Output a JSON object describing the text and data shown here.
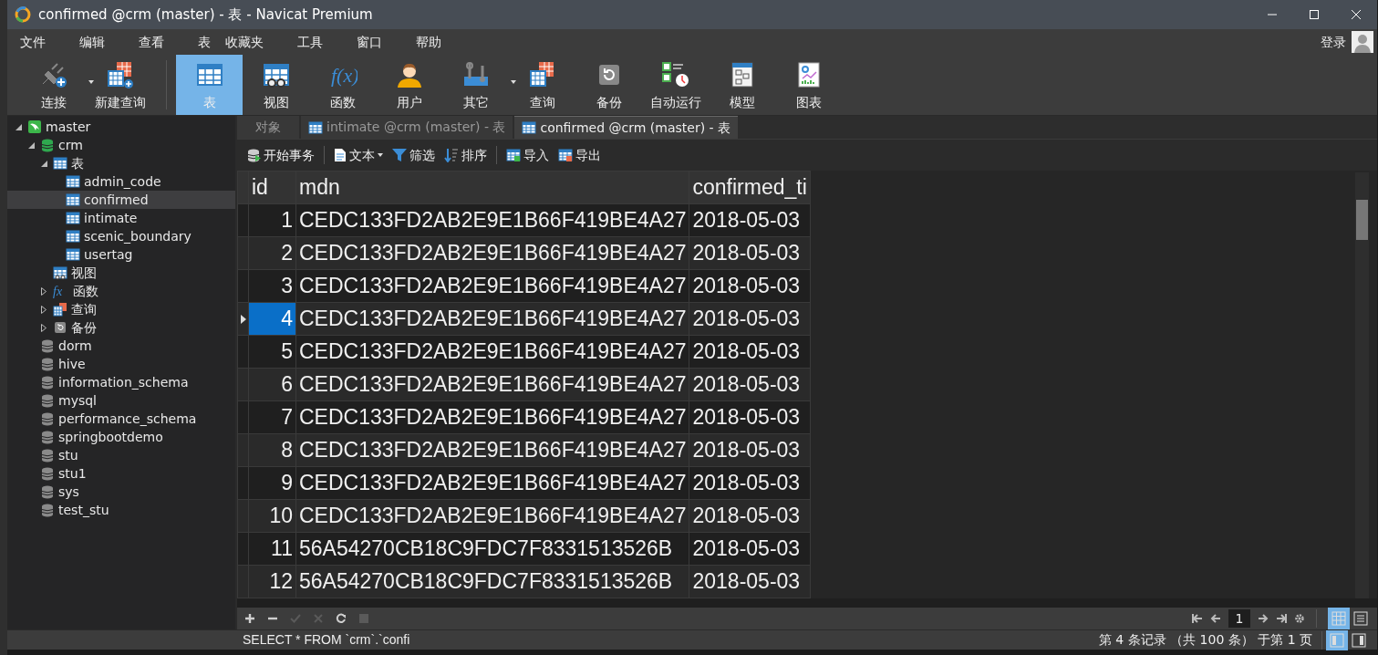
{
  "window": {
    "title": "confirmed @crm (master) - 表 - Navicat Premium"
  },
  "menu": [
    "文件",
    "编辑",
    "查看",
    "表",
    "收藏夹",
    "工具",
    "窗口",
    "帮助"
  ],
  "login": "登录",
  "toolbar": [
    {
      "label": "连接",
      "kind": "connect",
      "dropdown": true,
      "selected": false
    },
    {
      "label": "新建查询",
      "kind": "newquery",
      "dropdown": false,
      "selected": false
    },
    {
      "label": "表",
      "kind": "table",
      "dropdown": false,
      "selected": true
    },
    {
      "label": "视图",
      "kind": "view",
      "dropdown": false,
      "selected": false
    },
    {
      "label": "函数",
      "kind": "function",
      "icon_text": "f(x)",
      "dropdown": false,
      "selected": false
    },
    {
      "label": "用户",
      "kind": "user",
      "dropdown": false,
      "selected": false
    },
    {
      "label": "其它",
      "kind": "other",
      "dropdown": true,
      "selected": false
    },
    {
      "label": "查询",
      "kind": "query",
      "dropdown": false,
      "selected": false
    },
    {
      "label": "备份",
      "kind": "backup",
      "dropdown": false,
      "selected": false
    },
    {
      "label": "自动运行",
      "kind": "schedule",
      "dropdown": false,
      "selected": false
    },
    {
      "label": "模型",
      "kind": "model",
      "dropdown": false,
      "selected": false
    },
    {
      "label": "图表",
      "kind": "chart",
      "dropdown": false,
      "selected": false
    }
  ],
  "sidebar": {
    "tree": [
      {
        "label": "master",
        "kind": "server",
        "expanded": true,
        "selected": false,
        "children": [
          {
            "label": "crm",
            "kind": "db-open",
            "expanded": true,
            "selected": false,
            "children": [
              {
                "label": "表",
                "kind": "table",
                "expanded": true,
                "selected": false,
                "children": [
                  {
                    "label": "admin_code",
                    "kind": "table",
                    "selected": false
                  },
                  {
                    "label": "confirmed",
                    "kind": "table",
                    "selected": true
                  },
                  {
                    "label": "intimate",
                    "kind": "table",
                    "selected": false
                  },
                  {
                    "label": "scenic_boundary",
                    "kind": "table",
                    "selected": false
                  },
                  {
                    "label": "usertag",
                    "kind": "table",
                    "selected": false
                  }
                ]
              },
              {
                "label": "视图",
                "kind": "view",
                "selected": false
              },
              {
                "label": "函数",
                "kind": "function",
                "icon_text": "fx",
                "expanded": false,
                "selected": false
              },
              {
                "label": "查询",
                "kind": "query",
                "expanded": false,
                "selected": false
              },
              {
                "label": "备份",
                "kind": "backup",
                "expanded": false,
                "selected": false
              }
            ]
          },
          {
            "label": "dorm",
            "kind": "db",
            "selected": false
          },
          {
            "label": "hive",
            "kind": "db",
            "selected": false
          },
          {
            "label": "information_schema",
            "kind": "db",
            "selected": false
          },
          {
            "label": "mysql",
            "kind": "db",
            "selected": false
          },
          {
            "label": "performance_schema",
            "kind": "db",
            "selected": false
          },
          {
            "label": "springbootdemo",
            "kind": "db",
            "selected": false
          },
          {
            "label": "stu",
            "kind": "db",
            "selected": false
          },
          {
            "label": "stu1",
            "kind": "db",
            "selected": false
          },
          {
            "label": "sys",
            "kind": "db",
            "selected": false
          },
          {
            "label": "test_stu",
            "kind": "db",
            "selected": false
          }
        ]
      }
    ]
  },
  "tabs": [
    {
      "label": "对象",
      "kind": "objects",
      "selected": false
    },
    {
      "label": "intimate @crm (master) - 表",
      "kind": "table",
      "selected": false
    },
    {
      "label": "confirmed @crm (master) - 表",
      "kind": "table",
      "selected": true
    }
  ],
  "grid_toolbar": [
    {
      "label": "开始事务",
      "kind": "transaction",
      "dropdown": false
    },
    {
      "label": "文本",
      "kind": "text",
      "dropdown": true
    },
    {
      "label": "筛选",
      "kind": "filter",
      "dropdown": false
    },
    {
      "label": "排序",
      "kind": "sort",
      "dropdown": false
    },
    {
      "label": "导入",
      "kind": "import",
      "dropdown": false
    },
    {
      "label": "导出",
      "kind": "export",
      "dropdown": false
    }
  ],
  "table": {
    "columns": [
      "id",
      "mdn",
      "confirmed_ti"
    ],
    "rows": [
      {
        "cells": [
          "1",
          "CEDC133FD2AB2E9E1B66F419BE4A27",
          "2018-05-03"
        ],
        "selected": false
      },
      {
        "cells": [
          "2",
          "CEDC133FD2AB2E9E1B66F419BE4A27",
          "2018-05-03"
        ],
        "selected": false
      },
      {
        "cells": [
          "3",
          "CEDC133FD2AB2E9E1B66F419BE4A27",
          "2018-05-03"
        ],
        "selected": false
      },
      {
        "cells": [
          "4",
          "CEDC133FD2AB2E9E1B66F419BE4A27",
          "2018-05-03"
        ],
        "selected": true
      },
      {
        "cells": [
          "5",
          "CEDC133FD2AB2E9E1B66F419BE4A27",
          "2018-05-03"
        ],
        "selected": false
      },
      {
        "cells": [
          "6",
          "CEDC133FD2AB2E9E1B66F419BE4A27",
          "2018-05-03"
        ],
        "selected": false
      },
      {
        "cells": [
          "7",
          "CEDC133FD2AB2E9E1B66F419BE4A27",
          "2018-05-03"
        ],
        "selected": false
      },
      {
        "cells": [
          "8",
          "CEDC133FD2AB2E9E1B66F419BE4A27",
          "2018-05-03"
        ],
        "selected": false
      },
      {
        "cells": [
          "9",
          "CEDC133FD2AB2E9E1B66F419BE4A27",
          "2018-05-03"
        ],
        "selected": false
      },
      {
        "cells": [
          "10",
          "CEDC133FD2AB2E9E1B66F419BE4A27",
          "2018-05-03"
        ],
        "selected": false
      },
      {
        "cells": [
          "11",
          "56A54270CB18C9FDC7F8331513526B",
          "2018-05-03"
        ],
        "selected": false
      },
      {
        "cells": [
          "12",
          "56A54270CB18C9FDC7F8331513526B",
          "2018-05-03"
        ],
        "selected": false
      }
    ]
  },
  "record_tools": [
    {
      "kind": "add",
      "disabled": false
    },
    {
      "kind": "remove",
      "disabled": false
    },
    {
      "kind": "apply",
      "disabled": true
    },
    {
      "kind": "discard",
      "disabled": true
    },
    {
      "kind": "refresh",
      "disabled": false
    },
    {
      "kind": "stop",
      "disabled": true
    }
  ],
  "pager": {
    "page": "1"
  },
  "view_modes": [
    {
      "kind": "grid",
      "selected": true
    },
    {
      "kind": "form",
      "selected": false
    }
  ],
  "status_bar": {
    "sql": "SELECT * FROM `crm`.`confi",
    "records": "第 4 条记录 （共 100 条） 于第 1 页"
  },
  "panes": [
    {
      "kind": "left",
      "selected": true
    },
    {
      "kind": "right",
      "selected": false
    }
  ]
}
